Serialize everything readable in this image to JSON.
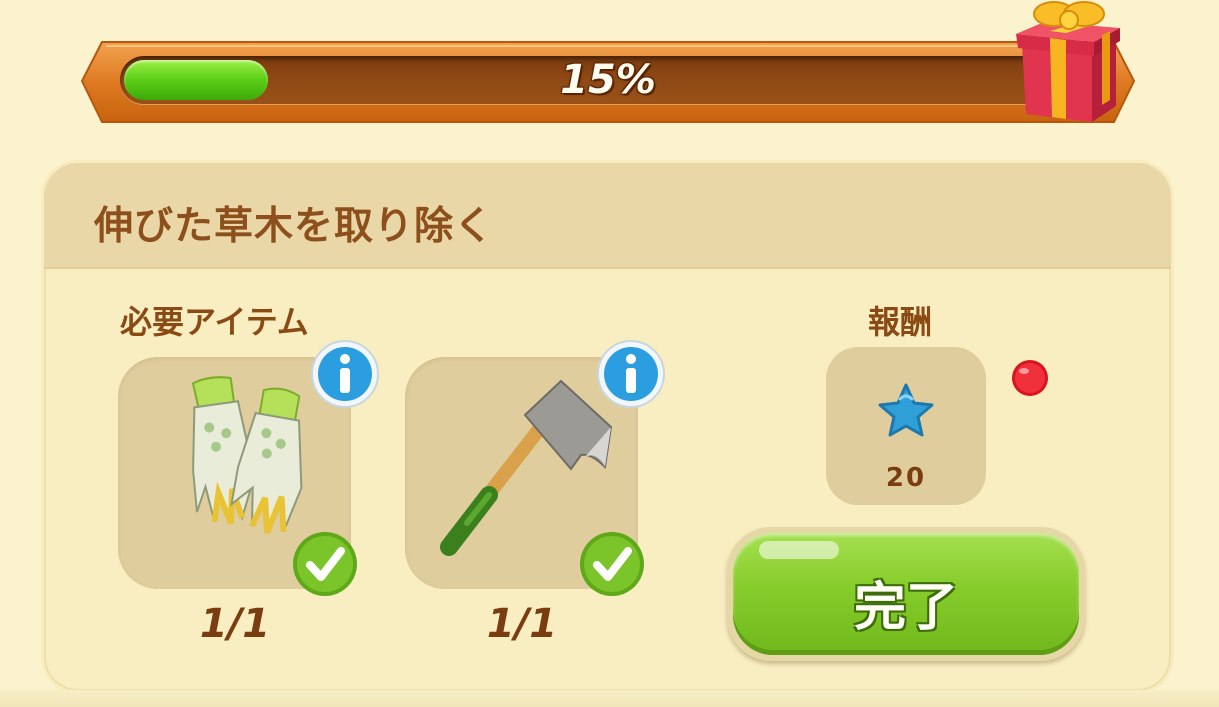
{
  "progress": {
    "percent": 15,
    "label": "15%",
    "fill_color": "#5fd118",
    "reward_icon": "gift-box-icon"
  },
  "task": {
    "title": "伸びた草木を取り除く",
    "required_label": "必要アイテム",
    "reward_label": "報酬",
    "items": [
      {
        "name": "gardening-gloves",
        "icon": "gloves-icon",
        "count": "1/1",
        "status": "complete"
      },
      {
        "name": "axe",
        "icon": "axe-icon",
        "count": "1/1",
        "status": "complete"
      }
    ],
    "reward": {
      "icon": "blue-star-icon",
      "value": "20",
      "color": "#2f9fd8"
    },
    "complete_button": {
      "label": "完了",
      "color": "#86cc2a",
      "has_notification": true
    }
  }
}
